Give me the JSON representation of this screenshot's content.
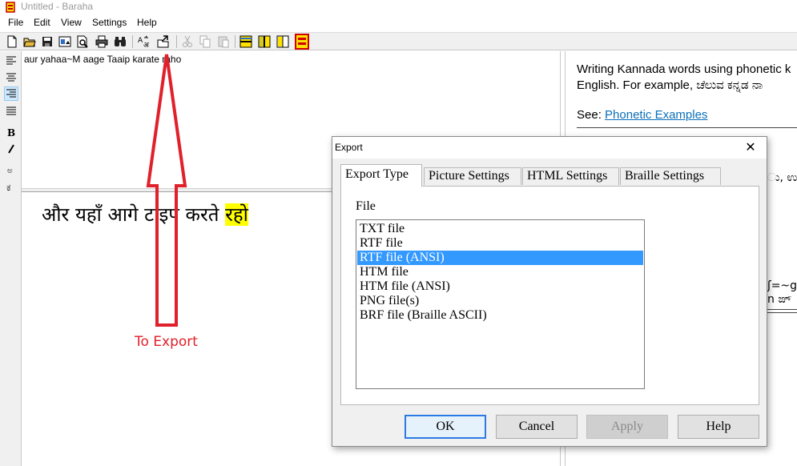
{
  "window": {
    "title": "Untitled - Baraha"
  },
  "menu": [
    "File",
    "Edit",
    "View",
    "Settings",
    "Help"
  ],
  "toolbar_icons": [
    "new-file-icon",
    "open-icon",
    "save-icon",
    "export-image-icon",
    "print-preview-icon",
    "print-icon",
    "find-icon",
    "convert-icon",
    "export-icon",
    "cut-icon",
    "copy-icon",
    "paste-icon",
    "horizontal-split-icon",
    "vertical-split-icon",
    "single-pane-icon",
    "layout-icon"
  ],
  "sidebar_icons": [
    "align-left-icon",
    "align-center-icon",
    "align-right-icon",
    "justify-icon",
    "bold-icon",
    "italic-icon",
    "kannada-letter-a-icon",
    "kannada-letter-ka-icon"
  ],
  "editor": {
    "roman_text": "aur yahaa~M aage Taaip karate raho",
    "devanagari_text": "और यहाँ आगे टाइप करते ",
    "devanagari_highlight": "रहो"
  },
  "annotation": {
    "label": "To Export",
    "color": "#e0202a"
  },
  "help_pane": {
    "line1": "Writing Kannada words using phonetic k",
    "line2": "English. For example, ಚೆಲುವ ಕನ್ನಡ ನಾ",
    "see_label": "See: ",
    "see_link": "Phonetic Examples",
    "frag1": "ು, ಉ",
    "frag2": "ʃ=~g",
    "frag3": "n ಙ್"
  },
  "dialog": {
    "title": "Export",
    "close": "✕",
    "tabs": [
      "Export Type",
      "Picture Settings",
      "HTML Settings",
      "Braille Settings"
    ],
    "active_tab": "Export Type",
    "file_label": "File",
    "file_options": [
      "TXT file",
      "RTF file",
      "RTF file (ANSI)",
      "HTM file",
      "HTM file (ANSI)",
      "PNG file(s)",
      "BRF file (Braille ASCII)"
    ],
    "selected_option": "RTF file (ANSI)",
    "buttons": {
      "ok": "OK",
      "cancel": "Cancel",
      "apply": "Apply",
      "help": "Help"
    }
  },
  "colors": {
    "selection": "#3399ff",
    "highlight": "#ffff00",
    "link": "#0b6fb8",
    "default_button_border": "#2c7be5"
  }
}
